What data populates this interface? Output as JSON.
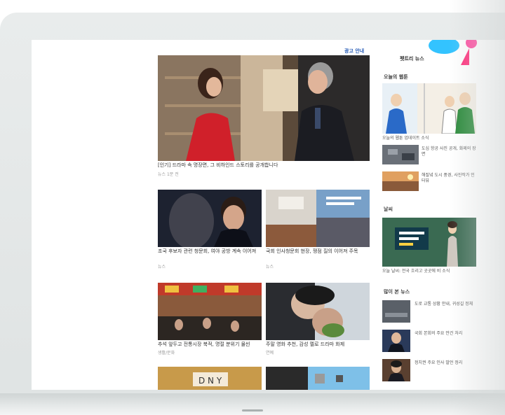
{
  "page": {
    "ad_label": "광고 안내",
    "logo_text": "펫트리 뉴스"
  },
  "main": {
    "feature": {
      "caption": "[인기] 드라마 속 명장면, 그 비하인드 스토리를 공개합니다",
      "source": "뉴스 1분 전"
    },
    "cards": [
      {
        "caption": "조국 후보자 관련 청문회, 여야 공방 계속 이어져",
        "source": "뉴스"
      },
      {
        "caption": "국회 인사청문회 현장, 쟁점 질의 이어져 주목",
        "source": "뉴스"
      },
      {
        "caption": "추석 앞두고 전통시장 북적, 명절 분위기 물씬",
        "source": "생활/문화"
      },
      {
        "caption": "주말 영화 추천, 감성 멜로 드라마 화제",
        "source": "연예"
      }
    ]
  },
  "sidebar": {
    "section1_title": "오늘의 웹툰",
    "items1": [
      {
        "text": "오늘의 웹툰 업데이트 소식"
      },
      {
        "text": "도심 항공 사진 공개, 화제의 장면"
      },
      {
        "text": "해질녘 도시 풍경, 사진작가 인터뷰"
      }
    ],
    "section2_title": "날씨",
    "weather_caption": "오늘 날씨: 전국 흐리고 곳곳에 비 소식",
    "section3_title": "많이 본 뉴스",
    "items3": [
      {
        "text": "도로 교통 상황 안내, 귀성길 정체"
      },
      {
        "text": "국회 본회의 주요 안건 처리"
      },
      {
        "text": "정치권 주요 인사 발언 정리"
      }
    ]
  }
}
